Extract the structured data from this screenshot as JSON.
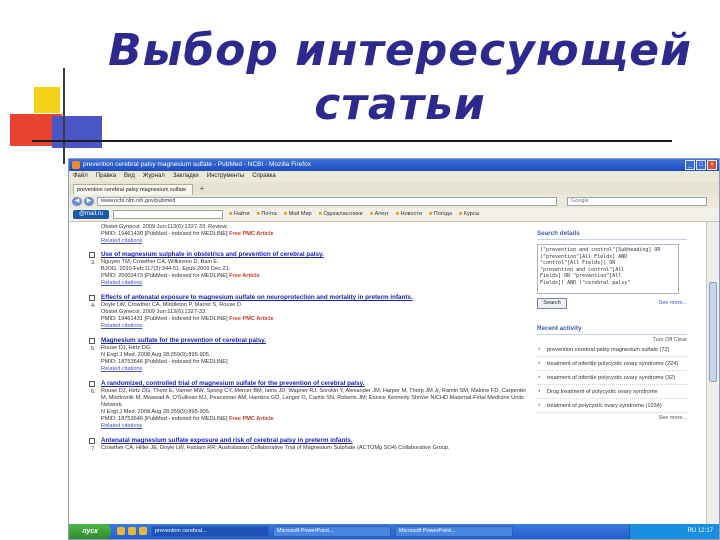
{
  "slide": {
    "title": "Выбор интересующей статьи"
  },
  "browser": {
    "window_title": "prevention cerebral palsy magnesium sulfate - PubMed - NCBI - Mozilla Firefox",
    "window_buttons": [
      "_",
      "□",
      "×"
    ],
    "menu": [
      "Файл",
      "Правка",
      "Вид",
      "Журнал",
      "Закладки",
      "Инструменты",
      "Справка"
    ],
    "tab_label": "prevention cerebral palsy magnesium sulfate",
    "tab_new": "+",
    "url": "www.ncbi.nlm.nih.gov/pubmed",
    "search_placeholder": "Google",
    "toolbar_brand": "@mail.ru",
    "toolbar_items": [
      "Найти",
      "Почта",
      "Мой Мир",
      "Одноклассники",
      "Агент",
      "Новости",
      "Погода",
      "Курсы"
    ]
  },
  "results": {
    "preamble_line": "Obstet Gynecol. 2009 Jun;113(6):1327-33. Review.",
    "preamble_pmid": "PMID: 19461430 [PubMed - indexed for MEDLINE]",
    "preamble_free": "Free PMC Article",
    "preamble_related": "Related citations",
    "items": [
      {
        "num": "3.",
        "title": "Use of magnesium sulphate in obstetrics and prevention of cerebral palsy.",
        "authors": "Nguyen TM, Crowther CA, Wilkinson D, Bain E.",
        "source": "BJOG. 2010 Feb;117(3):344-51. Epub 2009 Dec 21.",
        "pmid": "PMID: 20003473 [PubMed - indexed for MEDLINE]",
        "free": "Free Article",
        "related": "Related citations"
      },
      {
        "num": "4.",
        "title": "Effects of antenatal exposure to magnesium sulfate on neuroprotection and mortality in preterm infants.",
        "authors": "Doyle LW, Crowther CA, Middleton P, Marret S, Rouse D.",
        "source": "Obstet Gynecol. 2009 Jun;113(6):1327-33.",
        "pmid": "PMID: 19461431 [PubMed - indexed for MEDLINE]",
        "free": "Free PMC Article",
        "related": "Related citations"
      },
      {
        "num": "5.",
        "title": "Magnesium sulfate for the prevention of cerebral palsy.",
        "authors": "Rouse DJ, Hirtz DG.",
        "source": "N Engl J Med. 2008 Aug 28;359(9):895-905.",
        "pmid": "PMID: 18753646 [PubMed - indexed for MEDLINE]",
        "free": "",
        "related": "Related citations"
      },
      {
        "num": "6.",
        "title": "A randomized, controlled trial of magnesium sulfate for the prevention of cerebral palsy.",
        "authors": "Rouse DJ, Hirtz DG, Thom E, Varner MW, Spong CY, Mercer BM, Iams JD, Wapner RJ, Sorokin Y, Alexander JM, Harper M, Thorp JM Jr, Ramin SM, Malone FD, Carpenter M, Miodovnik M, Moawad A, O'Sullivan MJ, Peaceman AM, Hankins GD, Langer O, Caritis SN, Roberts JM; Eunice Kennedy Shriver NICHD Maternal-Fetal Medicine Units Network.",
        "source": "N Engl J Med. 2008 Aug 28;359(9):895-905.",
        "pmid": "PMID: 18753646 [PubMed - indexed for MEDLINE]",
        "free": "Free PMC Article",
        "related": "Related citations"
      },
      {
        "num": "7.",
        "title": "Antenatal magnesium sulfate exposure and risk of cerebral palsy in preterm infants.",
        "authors": "Crowther CA, Hiller JE, Doyle LW, Haslam RR; Australasian Collaborative Trial of Magnesium Sulphate (ACTOMg SO4) Collaborative Group.",
        "source": "",
        "pmid": "",
        "free": "",
        "related": ""
      }
    ]
  },
  "sidebar": {
    "search_details_title": "Search details",
    "search_details_text": "(\"prevention and control\"[Subheading] OR\n(\"prevention\"[All Fields] AND\n\"control\"[All Fields]) OR\n\"prevention and control\"[All\nFields] OR \"prevention\"[All\nFields]) AND (\"cerebral palsy\"",
    "search_button": "Search",
    "see_more": "See more...",
    "recent_title": "Recent activity",
    "recent_controls": "Turn Off  Clear",
    "recent_items": [
      "prevention cerebral palsy magnesium sulfate (72)",
      "treatment of infertile polycystic ovary syndrome (224)",
      "treatment of infertile polycystic ovary syndrome (32)",
      "Drug treatment of polycystic ovary syndrome",
      "treatment of polycystic ovary syndrome (1034)"
    ],
    "see_more_2": "See more..."
  },
  "taskbar": {
    "start_label": "пуск",
    "tasks": [
      "prevention cerebral...",
      "Microsoft PowerPoint...",
      "Microsoft PowerPoint..."
    ],
    "clock": "RU  12:17"
  }
}
